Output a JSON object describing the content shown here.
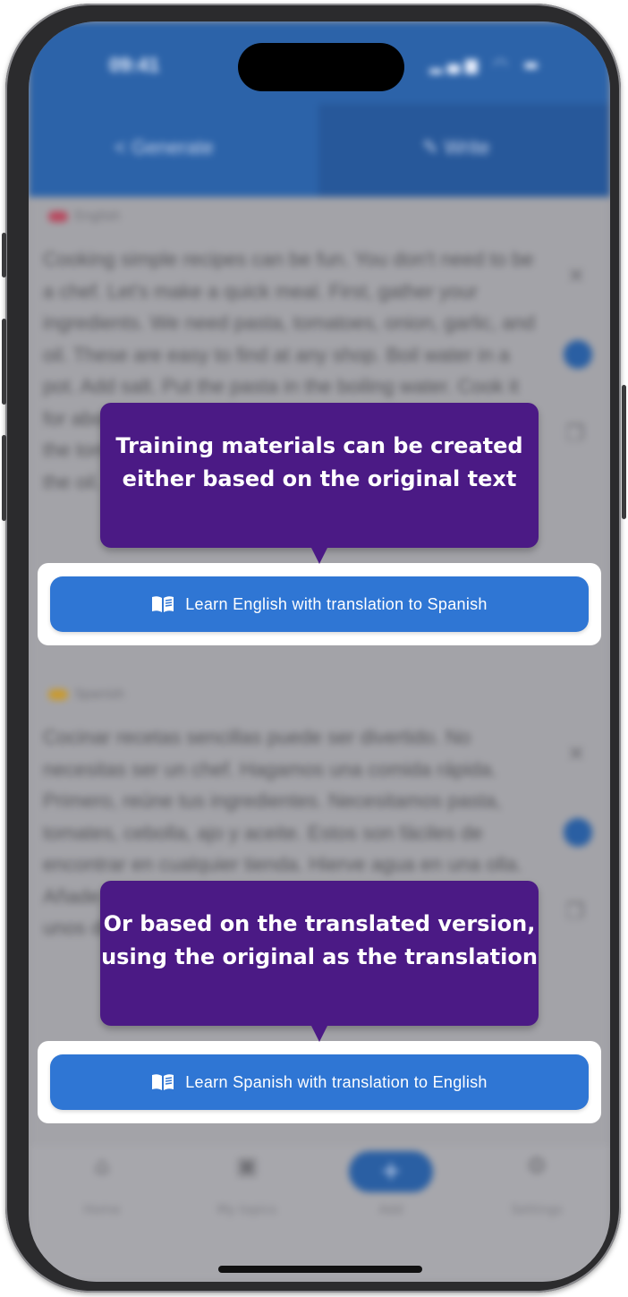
{
  "status_bar": {
    "time": "09:41"
  },
  "header": {
    "generate_tab": "< Generate",
    "write_tab": "✎ Write"
  },
  "sections": [
    {
      "language": "English",
      "text": "Cooking simple recipes can be fun. You don't need to be a chef. Let's make a quick meal. First, gather your ingredients. We need pasta, tomatoes, onion, garlic, and oil. These are easy to find at any shop. Boil water in a pot. Add salt. Put the pasta in the boiling water. Cook it for about ten minutes. While waiting, ten minutes, chop the tomatoes. Also chop the onion and garlic. Then heat the oil."
    },
    {
      "language": "Spanish",
      "text": "Cocinar recetas sencillas puede ser divertido. No necesitas ser un chef. Hagamos una comida rápida. Primero, reúne tus ingredientes. Necesitamos pasta, tomates, cebolla, ajo y aceite. Estos son fáciles de encontrar en cualquier tienda. Hierve agua en una olla. Añade sal. Pon la pasta en el agua hirviendo. Cocínala unos diez minutos."
    }
  ],
  "tooltips": [
    {
      "text": "Training materials can be created either based on the original text"
    },
    {
      "text": "Or based on the translated version, using the original as the translation"
    }
  ],
  "buttons": [
    {
      "label": "Learn English with translation to Spanish"
    },
    {
      "label": "Learn Spanish with translation to English"
    }
  ],
  "tab_bar": {
    "items": [
      {
        "label": "Home",
        "icon": "home-icon"
      },
      {
        "label": "My topics",
        "icon": "topics-icon"
      },
      {
        "label": "Add",
        "icon": "plus-icon"
      },
      {
        "label": "Settings",
        "icon": "gear-icon"
      }
    ]
  },
  "colors": {
    "accent_button": "#2f76d4",
    "tooltip_bg": "#4b1a85",
    "header_bg": "#2c63a9"
  }
}
